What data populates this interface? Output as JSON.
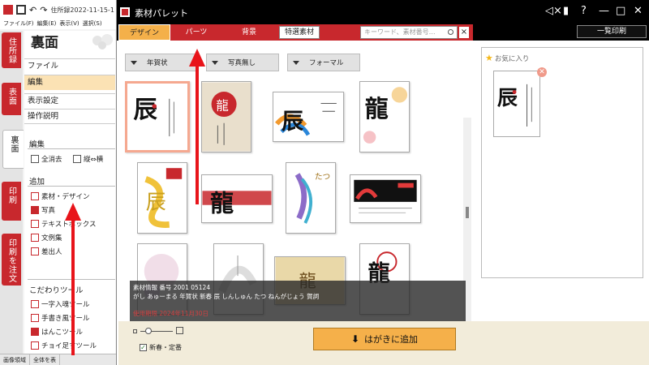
{
  "main_app": {
    "title": "住所録2022-11-15-1",
    "menubar": [
      "ファイル(F)",
      "編集(E)",
      "表示(V)",
      "選択(S)"
    ],
    "vertical_tabs": [
      "住所録",
      "表面",
      "裏面",
      "印刷",
      "印刷を注文"
    ],
    "panel_title": "裏面",
    "menu_items": [
      "ファイル",
      "編集",
      "表示設定",
      "操作説明"
    ],
    "edit_section": {
      "label": "編集",
      "tools": [
        "全消去",
        "縦⇔横"
      ]
    },
    "add_section": {
      "label": "追加",
      "tools": [
        "素材・デザイン",
        "写真",
        "テキストボックス",
        "文例集",
        "差出人"
      ]
    },
    "special_section": {
      "label": "こだわりツール",
      "tools": [
        "一字入魂ツール",
        "手書き風ツール",
        "はんこツール",
        "チョイ足すツール"
      ]
    },
    "status": [
      "画像領域",
      "全体を表"
    ]
  },
  "palette": {
    "title": "素材パレット",
    "tabs": [
      "デザイン",
      "パーツ",
      "背景",
      "特選素材"
    ],
    "search_placeholder": "キーワード、素材番号…",
    "clear_label": "×",
    "print_button": "一覧印刷",
    "filters": [
      "年賀状",
      "写真無し",
      "フォーマル"
    ],
    "thumbnails": [
      {
        "label": "辰"
      },
      {
        "label": "龍"
      },
      {
        "label": "辰"
      },
      {
        "label": "龍"
      },
      {
        "label": "辰"
      },
      {
        "label": "龍"
      },
      {
        "label": "たつ"
      },
      {
        "label": ""
      },
      {
        "label": ""
      },
      {
        "label": ""
      },
      {
        "label": "龍"
      },
      {
        "label": "龍"
      }
    ],
    "info": {
      "line1": "素材情報 番号 2001 05124",
      "line2": "がし あゅーまる 年賀状 新春 辰 しんしゅん たつ ねんがじょう 賀詞",
      "expiry": "使用期限 2024年11月30日"
    },
    "favorites_label": "お気に入り",
    "favorite_item": "辰",
    "new_year_check": "新春・定番",
    "add_button": "はがきに追加"
  },
  "colors": {
    "brand_red": "#c8282d",
    "tab_active": "#f4b04a",
    "add_button": "#f5b04a",
    "annotation_arrow": "#e8141a"
  }
}
